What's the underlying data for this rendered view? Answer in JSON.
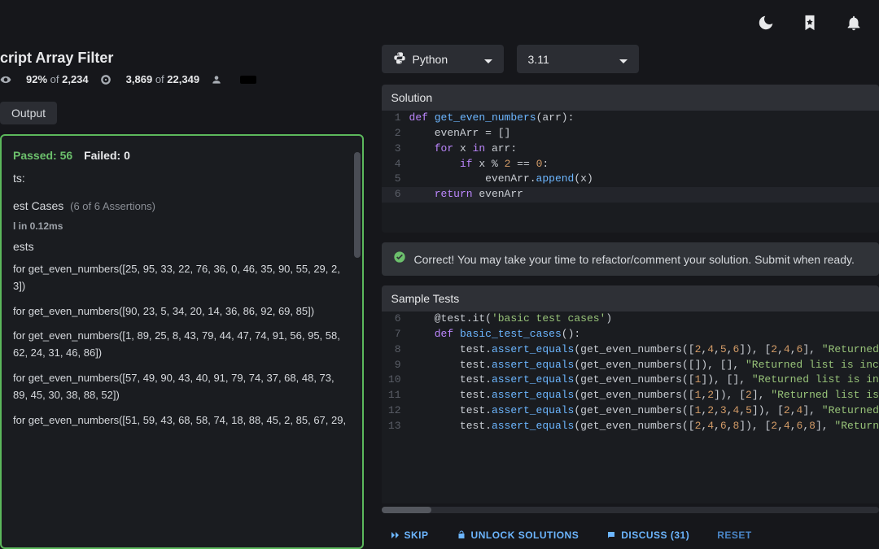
{
  "topbar": {
    "icons": [
      "moon",
      "bookmark",
      "bell"
    ]
  },
  "kata": {
    "title": "cript Array Filter",
    "satisfaction_pct": "92%",
    "satisfaction_total": "2,234",
    "completions": "3,869",
    "completions_total": "22,349"
  },
  "output_tab": "Output",
  "results": {
    "passed_label": "Passed: 56",
    "failed_label": "Failed: 0",
    "header": "ts:",
    "sub_header": "est Cases",
    "assert_meta": "(6 of 6 Assertions)",
    "time": "l in 0.12ms",
    "tests_label": "ests",
    "tests": [
      "for get_even_numbers([25, 95, 33, 22, 76, 36, 0, 46, 35, 90, 55, 29, 2, 3])",
      "for get_even_numbers([90, 23, 5, 34, 20, 14, 36, 86, 92, 69, 85])",
      "for get_even_numbers([1, 89, 25, 8, 43, 79, 44, 47, 74, 91, 56, 95, 58, 62, 24, 31, 46, 86])",
      "for get_even_numbers([57, 49, 90, 43, 40, 91, 79, 74, 37, 68, 48, 73, 89, 45, 30, 38, 88, 52])",
      "for get_even_numbers([51, 59, 43, 68, 58, 74, 18, 88, 45, 2, 85, 67, 29,"
    ]
  },
  "language_select": {
    "label": "Python",
    "icon": "python"
  },
  "version_select": {
    "label": "3.11"
  },
  "solution_header": "Solution",
  "solution_lines": [
    {
      "n": "1",
      "html": "<span class='kw'>def</span> <span class='fn'>get_even_numbers</span>(arr):"
    },
    {
      "n": "2",
      "html": "    evenArr = []"
    },
    {
      "n": "3",
      "html": "    <span class='kw'>for</span> x <span class='kw'>in</span> arr:"
    },
    {
      "n": "4",
      "html": "        <span class='kw'>if</span> x % <span class='num'>2</span> == <span class='num'>0</span>:"
    },
    {
      "n": "5",
      "html": "            evenArr.<span class='fn'>append</span>(x)"
    },
    {
      "n": "6",
      "html": "    <span class='kw'>return</span> evenArr",
      "current": true
    }
  ],
  "status": "Correct! You may take your time to refactor/comment your solution. Submit when ready.",
  "sample_header": "Sample Tests",
  "sample_lines": [
    {
      "n": "6",
      "html": "    @test.it(<span class='str'>'basic test cases'</span>)"
    },
    {
      "n": "7",
      "html": "    <span class='kw'>def</span> <span class='fn'>basic_test_cases</span>():"
    },
    {
      "n": "8",
      "html": "        test.<span class='fn'>assert_equals</span>(get_even_numbers([<span class='num'>2</span>,<span class='num'>4</span>,<span class='num'>5</span>,<span class='num'>6</span>]), [<span class='num'>2</span>,<span class='num'>4</span>,<span class='num'>6</span>], <span class='str'>\"Returned</span>"
    },
    {
      "n": "9",
      "html": "        test.<span class='fn'>assert_equals</span>(get_even_numbers([]), [], <span class='str'>\"Returned list is inc</span>"
    },
    {
      "n": "10",
      "html": "        test.<span class='fn'>assert_equals</span>(get_even_numbers([<span class='num'>1</span>]), [], <span class='str'>\"Returned list is in</span>"
    },
    {
      "n": "11",
      "html": "        test.<span class='fn'>assert_equals</span>(get_even_numbers([<span class='num'>1</span>,<span class='num'>2</span>]), [<span class='num'>2</span>], <span class='str'>\"Returned list is</span>"
    },
    {
      "n": "12",
      "html": "        test.<span class='fn'>assert_equals</span>(get_even_numbers([<span class='num'>1</span>,<span class='num'>2</span>,<span class='num'>3</span>,<span class='num'>4</span>,<span class='num'>5</span>]), [<span class='num'>2</span>,<span class='num'>4</span>], <span class='str'>\"Returned</span>"
    },
    {
      "n": "13",
      "html": "        test.<span class='fn'>assert_equals</span>(get_even_numbers([<span class='num'>2</span>,<span class='num'>4</span>,<span class='num'>6</span>,<span class='num'>8</span>]), [<span class='num'>2</span>,<span class='num'>4</span>,<span class='num'>6</span>,<span class='num'>8</span>], <span class='str'>\"Return</span>"
    }
  ],
  "actions": {
    "skip": "SKIP",
    "unlock": "UNLOCK SOLUTIONS",
    "discuss": "DISCUSS (31)",
    "reset": "RESET"
  }
}
